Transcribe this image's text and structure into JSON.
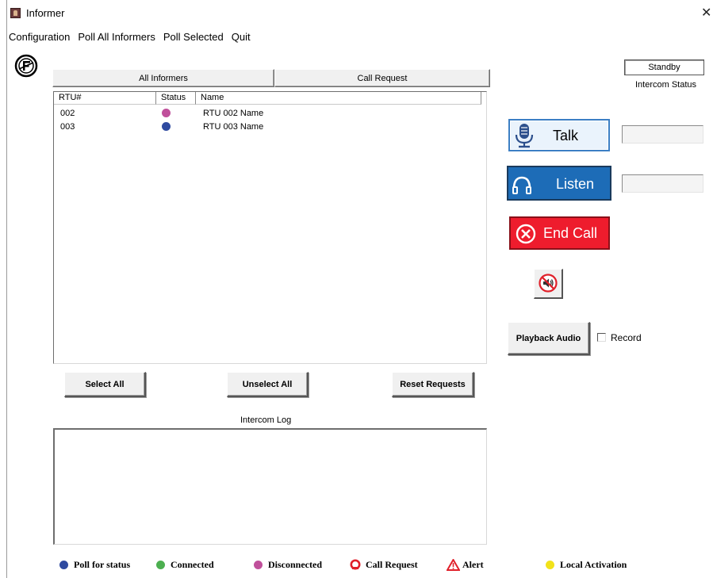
{
  "window": {
    "title": "Informer"
  },
  "menu": [
    "Configuration",
    "Poll All Informers",
    "Poll Selected",
    "Quit"
  ],
  "tabs": [
    {
      "label": "All Informers"
    },
    {
      "label": "Call Request"
    }
  ],
  "table": {
    "columns": [
      "RTU#",
      "Status",
      "Name"
    ],
    "rows": [
      {
        "rtu": "002",
        "status_color": "#c0509b",
        "name": "RTU 002 Name"
      },
      {
        "rtu": "003",
        "status_color": "#2f4aa0",
        "name": "RTU 003 Name"
      }
    ]
  },
  "buttons": {
    "select_all": "Select All",
    "unselect_all": "Unselect All",
    "reset_requests": "Reset Requests",
    "playback_audio": "Playback Audio"
  },
  "intercom_log_label": "Intercom Log",
  "intercom_status": {
    "value": "Standby",
    "label": "Intercom Status"
  },
  "talk": {
    "label": "Talk"
  },
  "listen": {
    "label": "Listen"
  },
  "end_call": {
    "label": "End Call"
  },
  "record": {
    "label": "Record",
    "checked": false
  },
  "legend": [
    {
      "label": "Poll for status",
      "icon": "dot",
      "color": "#2f4aa0"
    },
    {
      "label": "Connected",
      "icon": "dot",
      "color": "#4caf50"
    },
    {
      "label": "Disconnected",
      "icon": "dot",
      "color": "#c0509b"
    },
    {
      "label": "Call Request",
      "icon": "ring",
      "color": "#e0202a"
    },
    {
      "label": "Alert",
      "icon": "triangle",
      "color": "#e0202a"
    },
    {
      "label": "Local Activation",
      "icon": "dot",
      "color": "#f2e21a"
    }
  ]
}
